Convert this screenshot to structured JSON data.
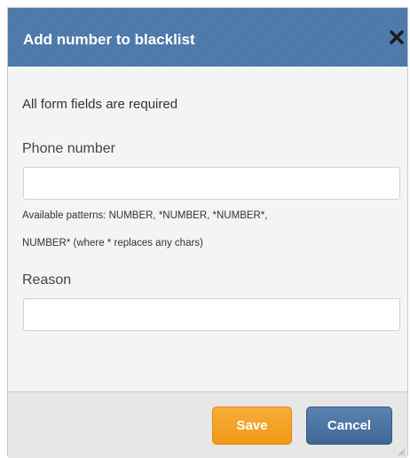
{
  "dialog": {
    "title": "Add number to blacklist",
    "close_icon": "close-x-icon",
    "required_notice": "All form fields are required",
    "phone": {
      "label": "Phone number",
      "value": "",
      "placeholder": ""
    },
    "hint_line1": "Available patterns: NUMBER, *NUMBER, *NUMBER*,",
    "hint_line2": "NUMBER* (where * replaces any chars)",
    "reason": {
      "label": "Reason",
      "value": "",
      "placeholder": ""
    },
    "buttons": {
      "save": "Save",
      "cancel": "Cancel"
    }
  },
  "colors": {
    "header": "#4a76a8",
    "save": "#f19914",
    "cancel": "#4a72a0",
    "footer": "#e7e7e7"
  }
}
